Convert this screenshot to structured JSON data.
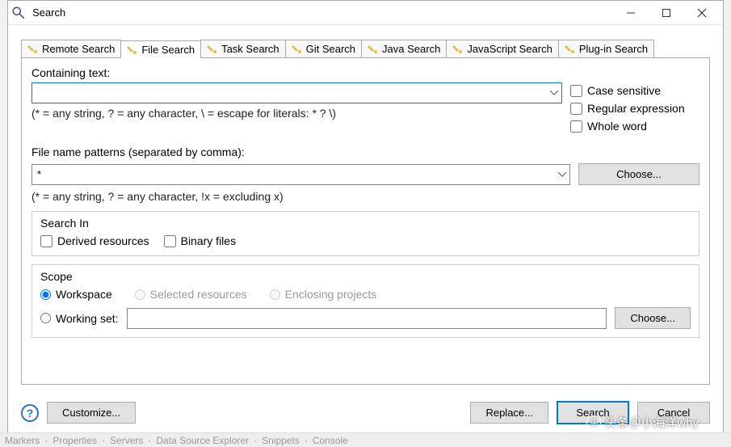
{
  "window": {
    "title": "Search"
  },
  "tabs": [
    {
      "label": "Remote Search"
    },
    {
      "label": "File Search",
      "active": true
    },
    {
      "label": "Task Search"
    },
    {
      "label": "Git Search"
    },
    {
      "label": "Java Search"
    },
    {
      "label": "JavaScript Search"
    },
    {
      "label": "Plug-in Search"
    }
  ],
  "containing": {
    "label": "Containing text:",
    "value": "",
    "hint": "(* = any string, ? = any character, \\ = escape for literals: * ? \\)"
  },
  "options": {
    "caseSensitive": "Case sensitive",
    "regex": "Regular expression",
    "wholeWord": "Whole word"
  },
  "patterns": {
    "label": "File name patterns (separated by comma):",
    "value": "*",
    "choose": "Choose...",
    "hint": "(* = any string, ? = any character, !x = excluding x)"
  },
  "searchIn": {
    "legend": "Search In",
    "derived": "Derived resources",
    "binary": "Binary files"
  },
  "scope": {
    "legend": "Scope",
    "workspace": "Workspace",
    "selected": "Selected resources",
    "enclosing": "Enclosing projects",
    "workingSet": "Working set:",
    "workingSetValue": "",
    "choose": "Choose..."
  },
  "footer": {
    "customize": "Customize...",
    "replace": "Replace...",
    "search": "Search",
    "cancel": "Cancel"
  },
  "statusbar": {
    "markers": "Markers",
    "properties": "Properties",
    "servers": "Servers",
    "dataSource": "Data Source Explorer",
    "snippets": "Snippets",
    "console": "Console"
  },
  "watermark": "头条＠小海洋why"
}
